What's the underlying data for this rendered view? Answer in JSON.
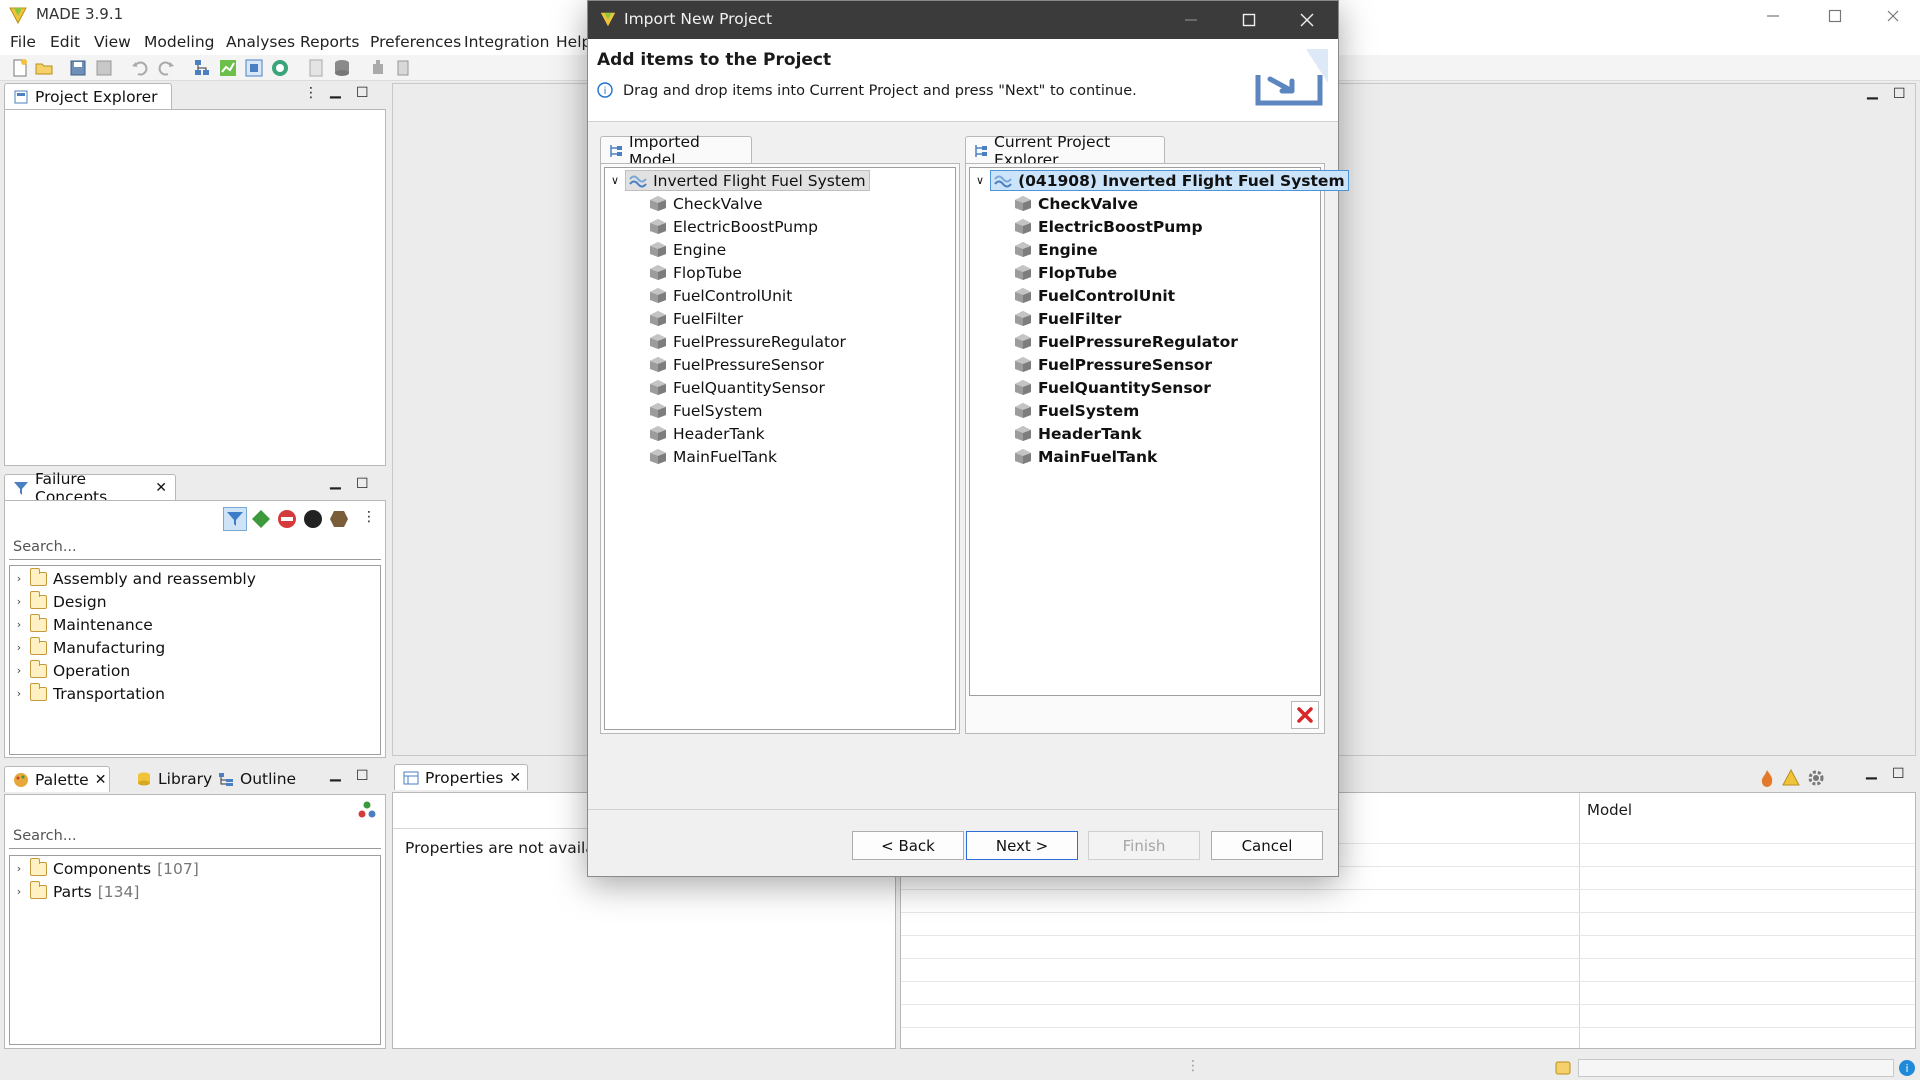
{
  "app": {
    "title": "MADE 3.9.1"
  },
  "menu": [
    "File",
    "Edit",
    "View",
    "Modeling",
    "Analyses",
    "Reports",
    "Preferences",
    "Integration",
    "Help"
  ],
  "views": {
    "project_explorer": {
      "tab": "Project Explorer"
    },
    "failure_concepts": {
      "tab": "Failure Concepts",
      "search_placeholder": "Search...",
      "items": [
        "Assembly and reassembly",
        "Design",
        "Maintenance",
        "Manufacturing",
        "Operation",
        "Transportation"
      ]
    },
    "palette": {
      "tabs": [
        "Palette",
        "Library",
        "Outline"
      ],
      "search_placeholder": "Search...",
      "items": [
        {
          "label": "Components",
          "count": "[107]"
        },
        {
          "label": "Parts",
          "count": "[134]"
        }
      ]
    },
    "properties": {
      "tab": "Properties",
      "message": "Properties are not available"
    },
    "table": {
      "column": "Model"
    }
  },
  "dialog": {
    "title": "Import New Project",
    "heading": "Add items to the Project",
    "info": "Drag and drop items into Current Project and press \"Next\" to continue.",
    "left_tab": "Imported Model",
    "right_tab": "Current Project Explorer",
    "imported_root": "Inverted Flight Fuel System",
    "project_root": "(041908) Inverted Flight Fuel System",
    "items": [
      "CheckValve",
      "ElectricBoostPump",
      "Engine",
      "FlopTube",
      "FuelControlUnit",
      "FuelFilter",
      "FuelPressureRegulator",
      "FuelPressureSensor",
      "FuelQuantitySensor",
      "FuelSystem",
      "HeaderTank",
      "MainFuelTank"
    ],
    "buttons": {
      "back": "< Back",
      "next": "Next >",
      "finish": "Finish",
      "cancel": "Cancel"
    }
  }
}
